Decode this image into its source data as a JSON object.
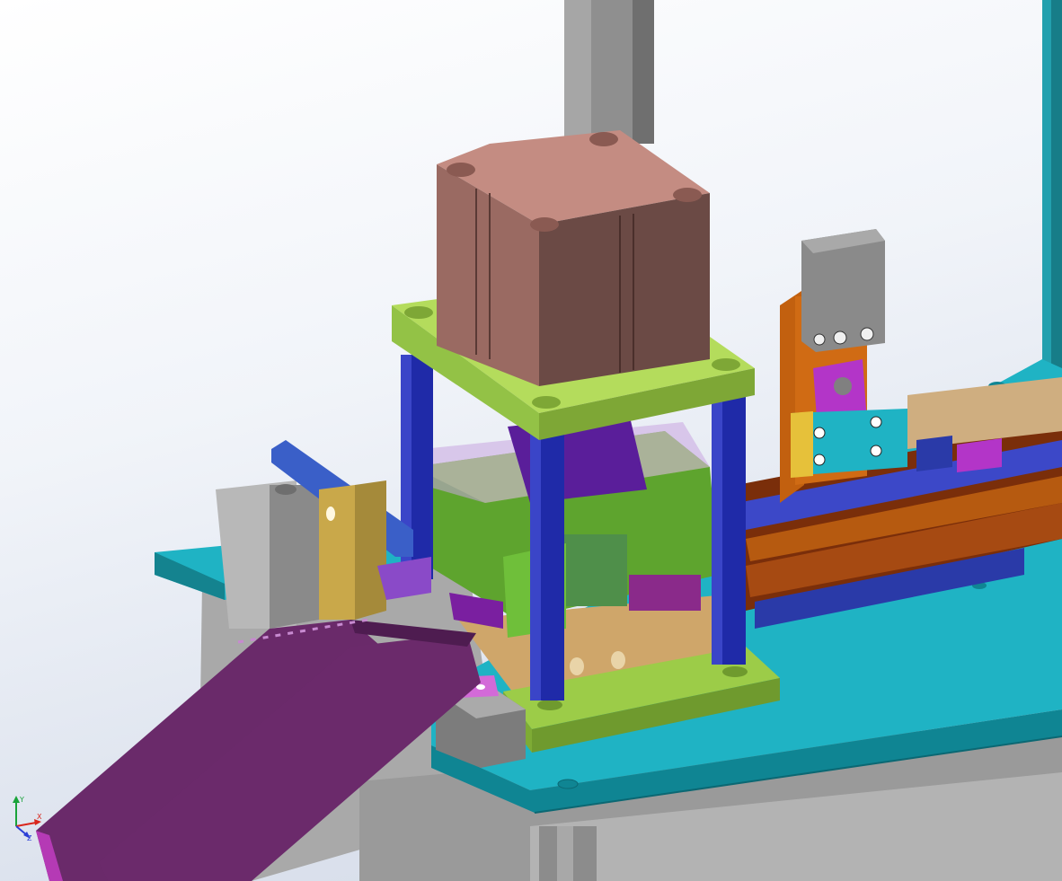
{
  "viewport": {
    "background_colors": [
      "#ffffff",
      "#dde3ee"
    ],
    "triad": {
      "x_label": "X",
      "y_label": "Y",
      "z_label": "Z",
      "x_color": "#d9261c",
      "y_color": "#1aa33a",
      "z_color": "#2c3fd6"
    }
  },
  "model": {
    "part_colors": {
      "cylinder_block": "#b9837a",
      "cylinder_side": "#6b4a45",
      "top_plate": "#9ccc48",
      "guide_posts": "#1f2aa8",
      "base_table": "#1fb3c4",
      "frame_grey": "#8a8a8a",
      "slide_chute": "#6a2a6a",
      "sensor_orange": "#d06b14",
      "rail_brown": "#8b3a0c",
      "air_cylinder": "#b8b8b8",
      "clamp_blue": "#3a5fc8",
      "die_green": "#5ea42e",
      "violet_clip": "#b335c8",
      "tan_block": "#caa572"
    }
  }
}
